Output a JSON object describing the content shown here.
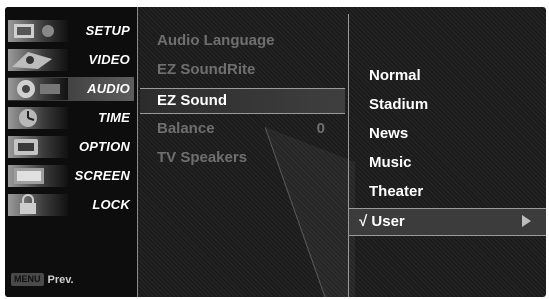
{
  "sidebar": {
    "items": [
      {
        "label": "SETUP",
        "icon": "setup-thumbnail-icon"
      },
      {
        "label": "VIDEO",
        "icon": "video-thumbnail-icon"
      },
      {
        "label": "AUDIO",
        "icon": "audio-thumbnail-icon",
        "active": true
      },
      {
        "label": "TIME",
        "icon": "time-thumbnail-icon"
      },
      {
        "label": "OPTION",
        "icon": "option-thumbnail-icon"
      },
      {
        "label": "SCREEN",
        "icon": "screen-thumbnail-icon"
      },
      {
        "label": "LOCK",
        "icon": "lock-thumbnail-icon"
      }
    ],
    "prev_key": "MENU",
    "prev_label": "Prev."
  },
  "submenu": {
    "items": [
      {
        "label": "Audio Language",
        "value": "",
        "state": "dim"
      },
      {
        "label": "EZ SoundRite",
        "value": "",
        "state": "dim"
      },
      {
        "label": "EZ Sound",
        "value": "",
        "state": "selected"
      },
      {
        "label": "Balance",
        "value": "0",
        "state": "dim"
      },
      {
        "label": "TV Speakers",
        "value": "",
        "state": "dim"
      }
    ]
  },
  "options": {
    "items": [
      {
        "label": "Normal"
      },
      {
        "label": "Stadium"
      },
      {
        "label": "News"
      },
      {
        "label": "Music"
      },
      {
        "label": "Theater"
      },
      {
        "label": "√ User",
        "current": true
      }
    ]
  },
  "colors": {
    "background": "#1b1b1b",
    "text": "#ffffff",
    "dim_text": "#6f6f6f",
    "highlight": "#3c3c3c"
  }
}
